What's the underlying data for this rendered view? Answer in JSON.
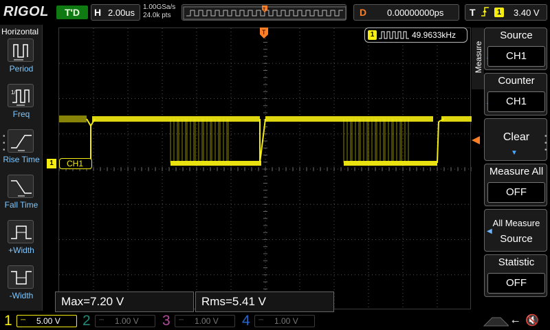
{
  "brand": "RIGOL",
  "run_state": "T'D",
  "timebase": {
    "letter": "H",
    "scale": "2.00us",
    "sample_rate": "1.00GSa/s",
    "memory_depth": "24.0k pts"
  },
  "trigger_position": {
    "marker": "T"
  },
  "delay": {
    "letter": "D",
    "value": "0.00000000ps"
  },
  "trigger": {
    "letter": "T",
    "edge": "rising-edge-icon",
    "source": "1",
    "level": "3.40 V"
  },
  "left_menu": {
    "title": "Horizontal",
    "items": [
      {
        "label": "Period",
        "icon": "period-icon"
      },
      {
        "label": "Freq",
        "icon": "frequency-icon"
      },
      {
        "label": "Rise Time",
        "icon": "rise-time-icon"
      },
      {
        "label": "Fall Time",
        "icon": "fall-time-icon"
      },
      {
        "label": "+Width",
        "icon": "positive-width-icon"
      },
      {
        "label": "-Width",
        "icon": "negative-width-icon"
      }
    ]
  },
  "channel_label": {
    "badge": "1",
    "name": "CH1"
  },
  "counter": {
    "badge": "1",
    "value": "49.9633kHz"
  },
  "measurements": [
    {
      "text": "Max=7.20 V"
    },
    {
      "text": "Rms=5.41 V"
    }
  ],
  "right_menu": {
    "tab": "Measure",
    "source": {
      "title": "Source",
      "value": "CH1"
    },
    "counter": {
      "title": "Counter",
      "value": "CH1"
    },
    "clear": {
      "title": "Clear"
    },
    "measure_all": {
      "title": "Measure All",
      "value": "OFF"
    },
    "all_measure_source": {
      "line1": "All Measure",
      "line2": "Source"
    },
    "statistic": {
      "title": "Statistic",
      "value": "OFF"
    }
  },
  "channels": [
    {
      "num": "1",
      "scale": "5.00 V",
      "color": "#f6ee11",
      "active": true
    },
    {
      "num": "2",
      "scale": "1.00 V",
      "color": "#1f8a78",
      "active": false
    },
    {
      "num": "3",
      "scale": "1.00 V",
      "color": "#b24a9a",
      "active": false
    },
    {
      "num": "4",
      "scale": "1.00 V",
      "color": "#2366c8",
      "active": false
    }
  ],
  "status_icons": [
    "usb-icon",
    "speaker-mute-icon"
  ],
  "colors": {
    "ch1": "#f6ee11",
    "accent_blue": "#49a8ff",
    "trigger_orange": "#ff7f27",
    "run_green": "#0f7a12"
  }
}
